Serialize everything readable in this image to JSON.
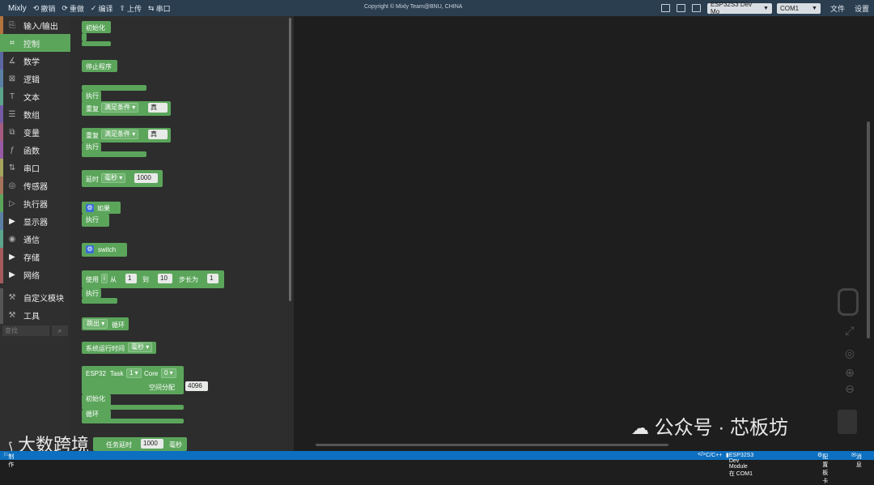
{
  "topbar": {
    "brand": "Mixly",
    "undo": "撤销",
    "redo": "重做",
    "compile": "编译",
    "upload": "上传",
    "serial": "串口",
    "copyright": "Copyright © Mixly Team@BNU, CHINA",
    "board_select": "ESP32S3 Dev Mo",
    "port_select": "COM1",
    "file_menu": "文件",
    "settings_menu": "设置"
  },
  "sidebar": {
    "items": [
      {
        "label": "输入/输出",
        "color": "#b3743e"
      },
      {
        "label": "控制",
        "color": "#5ba55b"
      },
      {
        "label": "数学",
        "color": "#5b67a5"
      },
      {
        "label": "逻辑",
        "color": "#5b80a5"
      },
      {
        "label": "文本",
        "color": "#5ba58c"
      },
      {
        "label": "数组",
        "color": "#745ba5"
      },
      {
        "label": "变量",
        "color": "#a55b80"
      },
      {
        "label": "函数",
        "color": "#995ba5"
      },
      {
        "label": "串口",
        "color": "#a5a55b"
      },
      {
        "label": "传感器",
        "color": "#a5745b"
      },
      {
        "label": "执行器",
        "color": "#5ba55b"
      },
      {
        "label": "显示器",
        "color": "#5b80a5"
      },
      {
        "label": "通信",
        "color": "#5ba58c"
      },
      {
        "label": "存储",
        "color": "#a55b5b"
      },
      {
        "label": "网络",
        "color": "#a55b5b"
      }
    ],
    "custom_module": "自定义模块",
    "tools": "工具",
    "search_placeholder": "查找"
  },
  "blocks": {
    "init": "初始化",
    "stop": "停止程序",
    "exec": "执行",
    "repeat": "重复",
    "condition_dd": "满足条件",
    "true_val": "真",
    "delay": "延时",
    "ms_dd": "毫秒",
    "delay_val": "1000",
    "if": "如果",
    "switch": "switch",
    "use": "使用",
    "var_i": "i",
    "from": "从",
    "from_val": "1",
    "to": "到",
    "to_val": "10",
    "step": "步长为",
    "step_val": "1",
    "break_dd": "跳出",
    "loop": "循环",
    "runtime": "系统运行时间",
    "runtime_dd": "毫秒",
    "esp32": "ESP32",
    "task": "Task",
    "task_val": "1",
    "core": "Core",
    "core_val": "0",
    "space": "空间分配",
    "space_val": "4096",
    "loop_label": "循环",
    "task_delay": "任务延时",
    "task_delay_val": "1000",
    "task_delay_unit": "毫秒"
  },
  "status": {
    "left": "制作",
    "lang": "C/C++",
    "board": "ESP32S3 Dev Module 在 COM1",
    "config": "配置板卡",
    "msg": "消息"
  },
  "watermark": {
    "left": "大数跨境",
    "right": "公众号 · 芯板坊"
  }
}
